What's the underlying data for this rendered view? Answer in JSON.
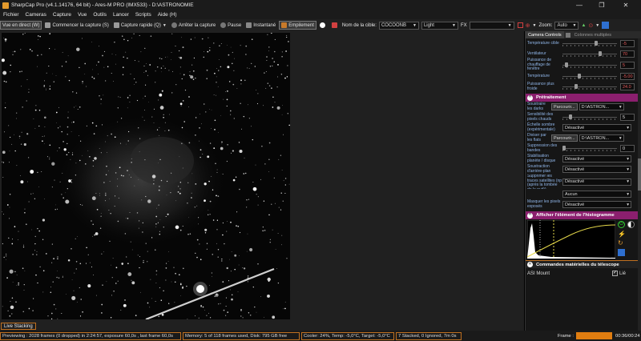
{
  "titlebar": {
    "title": "SharpCap Pro (v4.1.14176, 64 bit) - Ares-M PRO (IMX533) - D:\\ASTRONOMIE",
    "minimize": "—",
    "maximize": "❐",
    "close": "✕"
  },
  "menu": [
    "Fichier",
    "Cameras",
    "Capture",
    "Vue",
    "Outils",
    "Lancer",
    "Scripts",
    "Aide (H)"
  ],
  "toolbar": {
    "live_view": "Vue en direct (W)",
    "start_capture": "Commencer la capture (S)",
    "quick_capture": "Capture rapide (Q)",
    "stop_capture": "Arrêter la capture",
    "pause": "Pause",
    "snapshot": "Instantané",
    "stacking": "Empilement",
    "target_label": "Nom de la cible:",
    "target_value": "COCOONB",
    "frame_type": "Light",
    "fx_label": "FX",
    "fx_value": "",
    "zoom_label": "Zoom:",
    "zoom_value": "Auto"
  },
  "live_stacking_tab": "Live Stacking",
  "status": {
    "preview": "Previewing : 2028 frames (0 dropped) in 2:24:57, exposure 60,0s , last frame 60,0s",
    "memory": "Memory: 5 of 118 frames used, Disk: 795 GB free",
    "cooler": "Cooler: 24%, Temp: -5,0°C, Target: -5,0°C",
    "stack": "7 Stacked, 0 Ignored, 7m 0s",
    "frame_label": "Frame :",
    "timer": "00:36/00:24"
  },
  "panel": {
    "tabs": [
      "Camera Controls",
      "Colonnes multiples"
    ],
    "camera_rows": [
      {
        "label": "Température cible",
        "value": "-5",
        "warn": true,
        "level": 0.62
      },
      {
        "label": "Ventilateur",
        "value": "70",
        "warn": true,
        "level": 0.7
      },
      {
        "label": "Puissance de chauffage de fenêtre",
        "value": "5",
        "warn": true,
        "level": 0.05
      },
      {
        "label": "Température",
        "value": "-5.00",
        "warn": true,
        "level": 0.3
      },
      {
        "label": "Puissance plus froide",
        "value": "24.0",
        "warn": true,
        "level": 0.24
      }
    ],
    "pretreatment": {
      "title": "Prétraitement",
      "subtract_darks_label": "Soustraire les darks",
      "browse1": "Parcourir...",
      "path1": "D:\\ASTRON...",
      "hot_pixels_label": "Sensibilité des pixels chauds",
      "hot_pixels_value": "5",
      "hot_pixels_level": 0.12,
      "dark_scale_label": "Échelle sombre (expérimentale)",
      "dark_scale_value": "Désactivé",
      "flats_label": "Diviser par les flats",
      "browse2": "Parcourir...",
      "path2": "D:\\ASTRON...",
      "banding_label": "Suppression des bandes",
      "banding_value": "0",
      "banding_level": 0.0,
      "planet_label": "Stabilisation planète / disque",
      "planet_value": "Désactivé",
      "bg_label": "Soustraction d'arrière-plan",
      "bg_value": "Désactivé",
      "sat_label": "Supprimer les traces satellites (np (après la tombée de la nuit))",
      "sat_value": "Désactivé",
      "aux_value": "Aucun",
      "mask_label": "Masquer les pixels exposés",
      "mask_value": "Désactivé"
    },
    "histogram_title": "Afficher l'élément de l'histogramme",
    "mount_section": "Commandes matérielles du télescope",
    "mount_name": "ASI Mount",
    "mount_check_label": "Lié"
  },
  "colors": {
    "accent_orange": "#c07020",
    "section_magenta": "#8b1f6e",
    "label_blue": "#8fb4e6",
    "warn_red": "#e85a5a"
  }
}
